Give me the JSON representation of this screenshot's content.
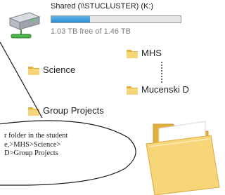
{
  "drive": {
    "name": "Shared (\\\\STUCLUSTER) (K:)",
    "free_text": "1.03 TB free of 1.46 TB",
    "used_fraction": 0.3,
    "bar_color": "#2a8fd4",
    "icon": "network-drive-icon"
  },
  "folders": {
    "mhs": {
      "label": "MHS",
      "icon": "folder-icon"
    },
    "science": {
      "label": "Science",
      "icon": "folder-icon"
    },
    "mucenski": {
      "label": "Mucenski D",
      "icon": "folder-icon"
    },
    "group_projects": {
      "label": "Group Projects",
      "icon": "folder-icon"
    }
  },
  "large_folder": {
    "icon": "large-folder-icon"
  },
  "callout": {
    "lines": [
      "r folder in the student",
      "e,>MHS>Science>",
      "D>Group Projects"
    ]
  },
  "colors": {
    "folder_front": "#f7d67a",
    "folder_back": "#e2b13c",
    "outline": "#1a1a1a"
  }
}
